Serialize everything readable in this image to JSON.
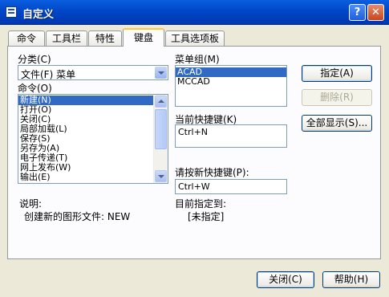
{
  "window": {
    "title": "自定义",
    "help_label": "?",
    "close_label": "✕"
  },
  "tabs": [
    {
      "label": "命令"
    },
    {
      "label": "工具栏"
    },
    {
      "label": "特性"
    },
    {
      "label": "键盘"
    },
    {
      "label": "工具选项板"
    }
  ],
  "category": {
    "label": "分类(C)",
    "value": "文件(F) 菜单"
  },
  "commands": {
    "label": "命令(O)",
    "items": [
      "新建(N)",
      "打开(O)",
      "关闭(C)",
      "局部加载(L)",
      "保存(S)",
      "另存为(A)",
      "电子传递(T)",
      "网上发布(W)",
      "输出(E)"
    ]
  },
  "menu_group": {
    "label": "菜单组(M)",
    "items": [
      "ACAD",
      "MCCAD"
    ]
  },
  "current_keys": {
    "label": "当前快捷键(K)",
    "value": "Ctrl+N"
  },
  "new_key": {
    "label": "请按新快捷键(P):",
    "value": "Ctrl+W"
  },
  "description": {
    "label": "说明:",
    "text": "创建新的图形文件:  NEW"
  },
  "assigned": {
    "label": "目前指定到:",
    "value": "[未指定]"
  },
  "buttons": {
    "assign": "指定(A)",
    "remove": "删除(R)",
    "show_all": "全部显示(S)...",
    "close": "关闭(C)",
    "help": "帮助(H)"
  }
}
